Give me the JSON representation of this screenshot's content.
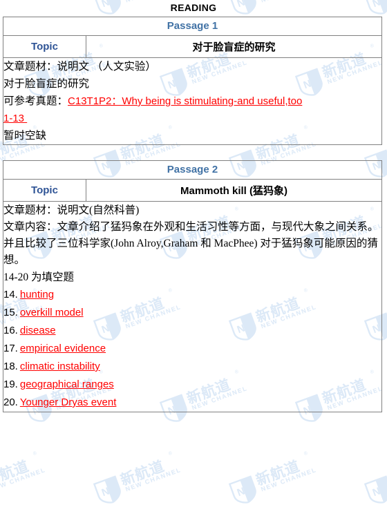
{
  "page": {
    "title": "READING",
    "watermark": {
      "logo_cn": "新航道",
      "logo_en": "NEW CHANNEL",
      "logo_mark": "NC",
      "registered_mark": "®",
      "color": "#dce9f7"
    },
    "colors": {
      "passage_header": "#4172a5",
      "topic_label": "#2e5395",
      "answer_red": "#ff0000",
      "border": "#808080",
      "text": "#000000"
    }
  },
  "passages": [
    {
      "header": "Passage 1",
      "topic_label": "Topic",
      "topic_value": "对于脸盲症的研究",
      "topic_value_is_cjk": true,
      "lines": [
        {
          "text": "文章题材：说明文 （人文实验）"
        },
        {
          "text": "对于脸盲症的研究"
        }
      ],
      "reference_label": "可参考真题：",
      "reference_link_line1": "C13T1P2：Why being is stimulating-and useful,too",
      "reference_link_line2": "1-13",
      "status_note": "暂时空缺",
      "answers": []
    },
    {
      "header": "Passage 2",
      "topic_label": "Topic",
      "topic_value": "Mammoth kill (猛犸象)",
      "topic_value_is_cjk": false,
      "lines": [
        {
          "text": "文章题材：说明文(自然科普)"
        },
        {
          "text": "文章内容：文章介绍了猛犸象在外观和生活习性等方面，与现代大象之间关系。并且比较了三位科学家(John Alroy,Graham 和 MacPhee) 对于猛犸象可能原因的猜想。"
        },
        {
          "text": "14-20 为填空题"
        }
      ],
      "answers": [
        {
          "num": "14.",
          "value": "hunting"
        },
        {
          "num": "15.",
          "value": "overkill model"
        },
        {
          "num": "16.",
          "value": "disease"
        },
        {
          "num": "17.",
          "value": "empirical evidence"
        },
        {
          "num": "18.",
          "value": "climatic instability"
        },
        {
          "num": "19.",
          "value": "geographical ranges"
        },
        {
          "num": "20.",
          "value": "Younger Dryas event"
        }
      ]
    }
  ]
}
